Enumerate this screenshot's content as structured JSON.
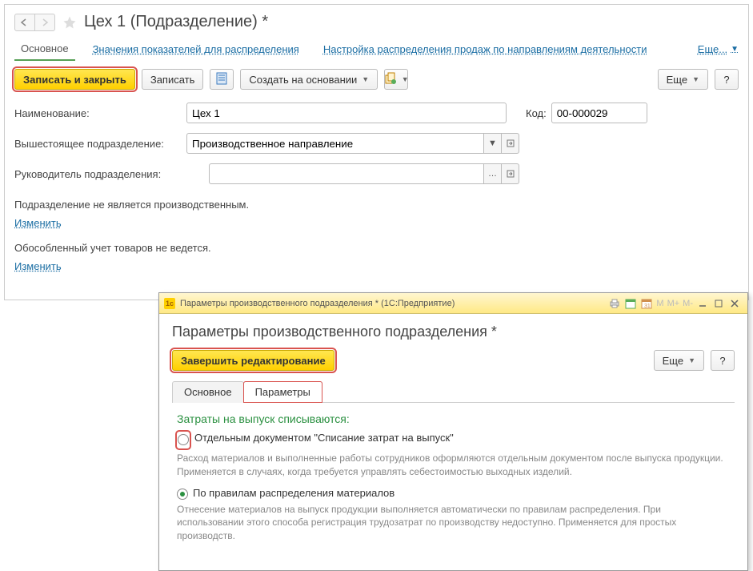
{
  "header": {
    "title": "Цех 1 (Подразделение) *"
  },
  "navTabs": {
    "main": "Основное",
    "values": "Значения показателей для распределения",
    "sales": "Настройка распределения продаж по направлениям деятельности",
    "more": "Еще..."
  },
  "toolbar": {
    "saveClose": "Записать и закрыть",
    "save": "Записать",
    "createBased": "Создать на основании",
    "more": "Еще",
    "help": "?"
  },
  "form": {
    "nameLabel": "Наименование:",
    "nameValue": "Цех 1",
    "codeLabel": "Код:",
    "codeValue": "00-000029",
    "parentLabel": "Вышестоящее подразделение:",
    "parentValue": "Производственное направление",
    "managerLabel": "Руководитель подразделения:",
    "managerValue": ""
  },
  "info": {
    "notProduction": "Подразделение не является производственным.",
    "change1": "Изменить",
    "noSeparateAccounting": "Обособленный учет товаров не ведется.",
    "change2": "Изменить"
  },
  "modal": {
    "titlebar": "Параметры производственного подразделения * (1С:Предприятие)",
    "title": "Параметры производственного подразделения *",
    "finish": "Завершить редактирование",
    "more": "Еще",
    "help": "?",
    "tabs": {
      "main": "Основное",
      "params": "Параметры"
    },
    "section": {
      "heading": "Затраты на выпуск списываются:",
      "opt1": "Отдельным документом \"Списание затрат на выпуск\"",
      "desc1": "Расход материалов и выполненные работы сотрудников оформляются отдельным документом после выпуска продукции. Применяется в случаях, когда требуется управлять себестоимостью выходных изделий.",
      "opt2": "По правилам распределения материалов",
      "desc2": "Отнесение материалов на выпуск продукции выполняется автоматически по правилам распределения. При использовании этого способа регистрация трудозатрат по производству недоступно. Применяется для простых производств."
    },
    "tbText": {
      "m": "M",
      "mp": "M+",
      "mm": "M-"
    }
  }
}
